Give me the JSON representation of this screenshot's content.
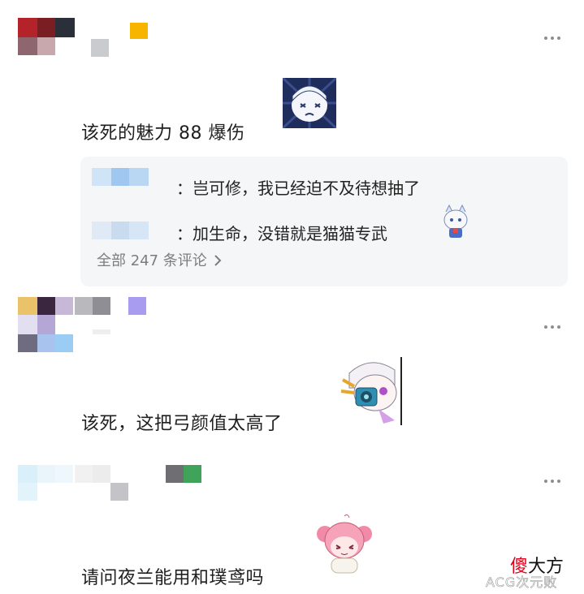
{
  "comments": [
    {
      "text": "该死的魅力 88 爆伤",
      "sticker": "chibi-girl-sticker",
      "replies": [
        {
          "text": "：岂可修，我已经迫不及待想抽了"
        },
        {
          "text": "：加生命，没错就是猫猫专武",
          "sticker": "chibi-catgirl-sticker"
        }
      ],
      "view_all": "全部 247 条评论"
    },
    {
      "text": "该死，这把弓颜值太高了",
      "sticker": "chibi-archer-sticker"
    },
    {
      "text": "请问夜兰能用和璞鸢吗",
      "sticker": "chibi-pink-hair-sticker"
    }
  ],
  "watermark": {
    "red_char": "傻",
    "rest": "大方",
    "sub": "ACG次元败"
  },
  "icons": {
    "more": "more-dots-icon",
    "chevron": "chevron-right-icon"
  },
  "colors": {
    "reply_bg": "#f5f6f7",
    "text": "#1f1f1f",
    "muted": "#7d7d7d",
    "watermark_red": "#e0001a"
  }
}
